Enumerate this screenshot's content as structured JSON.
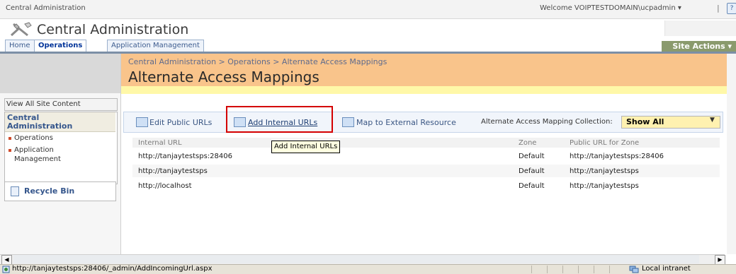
{
  "topbar": {
    "site_link": "Central Administration",
    "welcome_menu": "Welcome VOIPTESTDOMAIN\\ucpadmin ▾",
    "divider": "|"
  },
  "header": {
    "site_title": "Central Administration"
  },
  "tabs": [
    {
      "label": "Home",
      "active": false
    },
    {
      "label": "Operations",
      "active": true
    },
    {
      "label": "Application Management",
      "active": false
    }
  ],
  "site_actions": "Site Actions ▾",
  "leftnav": {
    "view_all": "View All Site Content",
    "section_title": "Central Administration",
    "links": [
      "Operations",
      "Application Management"
    ],
    "recycle_bin": "Recycle Bin"
  },
  "page": {
    "breadcrumb": "Central Administration > Operations > Alternate Access Mappings",
    "title": "Alternate Access Mappings"
  },
  "toolbar": {
    "edit_public_urls": "Edit Public URLs",
    "add_internal_urls": "Add Internal URLs",
    "map_external": "Map to External Resource",
    "collection_label": "Alternate Access Mapping Collection:",
    "collection_value": "Show All"
  },
  "tooltip": "Add Internal URLs",
  "table": {
    "headers": [
      "Internal URL",
      "Zone",
      "Public URL for Zone"
    ],
    "rows": [
      [
        "http://tanjaytestsps:28406",
        "Default",
        "http://tanjaytestsps:28406"
      ],
      [
        "http://tanjaytestsps",
        "Default",
        "http://tanjaytestsps"
      ],
      [
        "http://localhost",
        "Default",
        "http://tanjaytestsps"
      ]
    ]
  },
  "statusbar": {
    "url": "http://tanjaytestsps:28406/_admin/AddIncomingUrl.aspx",
    "zone": "Local intranet"
  },
  "colors": {
    "title_area": "#f9c48b",
    "toolbar_bg": "#f1f5fb",
    "highlight_border": "#d40000",
    "site_actions_bg": "#8a9a6d"
  },
  "icons": [
    "tools-logo-icon",
    "help-icon",
    "recycle-bin-icon",
    "edit-icon",
    "add-url-icon",
    "map-icon",
    "dropdown-arrow-icon",
    "browser-page-icon",
    "intranet-zone-icon"
  ]
}
